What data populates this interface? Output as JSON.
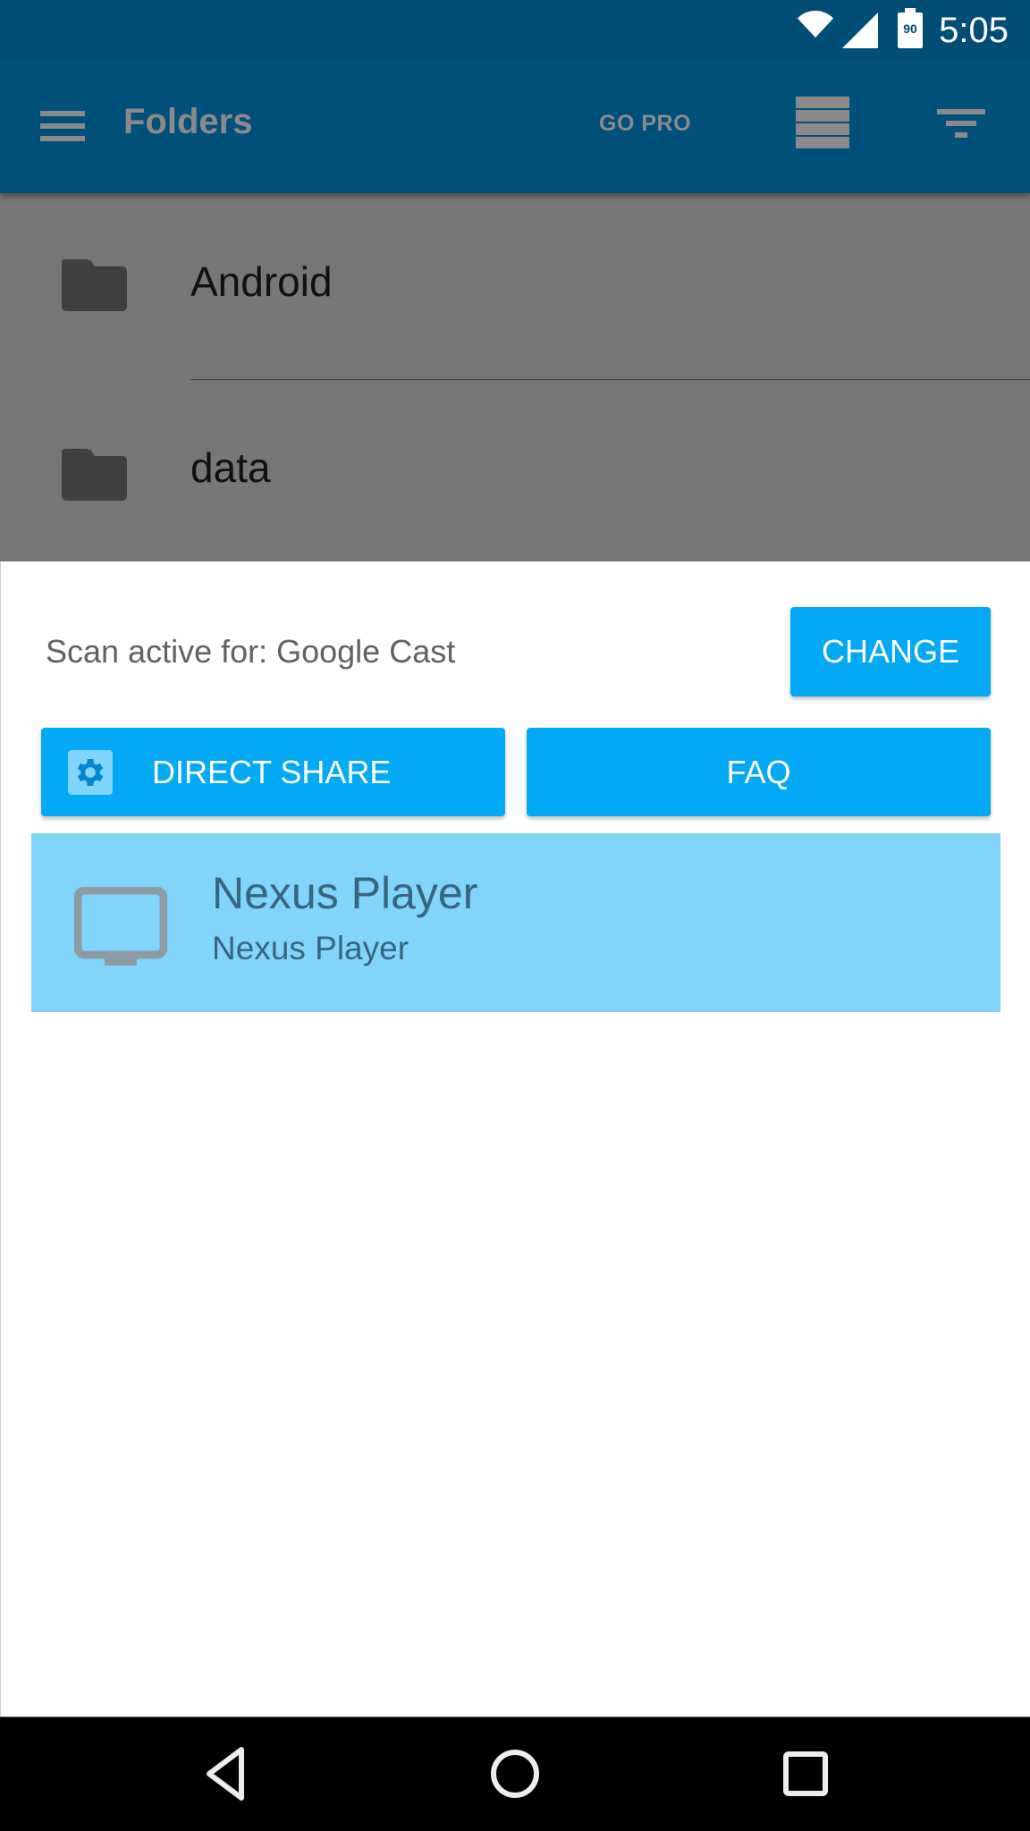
{
  "status_bar": {
    "time": "5:05",
    "battery_level": "90",
    "icons": [
      "wifi-icon",
      "cell-signal-icon",
      "battery-icon"
    ]
  },
  "toolbar": {
    "title": "Folders",
    "go_pro_label": "GO PRO",
    "icons": [
      "menu-icon",
      "list-view-icon",
      "filter-icon"
    ]
  },
  "folders": [
    {
      "name": "Android",
      "icon": "folder-icon"
    },
    {
      "name": "data",
      "icon": "folder-icon"
    }
  ],
  "cast_sheet": {
    "scan_status": "Scan active for: Google Cast",
    "change_label": "CHANGE",
    "direct_share_label": "DIRECT SHARE",
    "faq_label": "FAQ",
    "devices": [
      {
        "name": "Nexus Player",
        "subtitle": "Nexus Player",
        "icon": "tv-icon",
        "selected": true
      }
    ]
  },
  "nav_bar": {
    "buttons": [
      "back",
      "home",
      "recents"
    ]
  },
  "colors": {
    "status_bar": "#004d75",
    "toolbar": "#00507a",
    "accent_button": "#03a9f4",
    "selected_row": "#81d4fa",
    "scrim": "#777777"
  }
}
